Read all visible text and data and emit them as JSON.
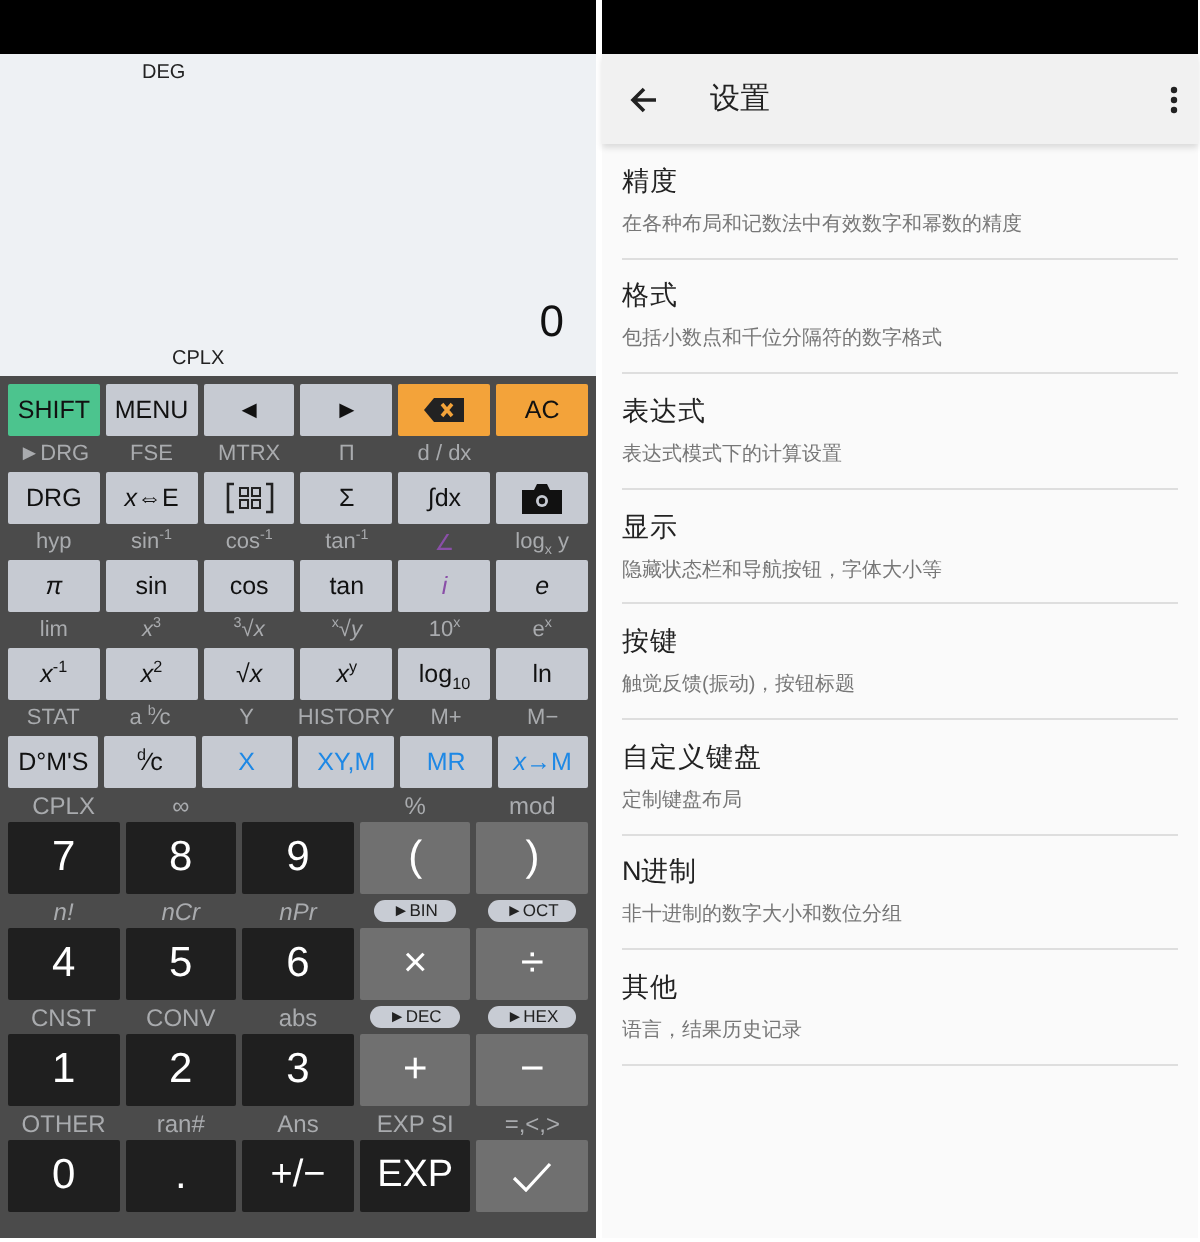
{
  "calculator": {
    "display": {
      "mode": "DEG",
      "value": "0",
      "indicator": "CPLX"
    },
    "rows": [
      {
        "keys": [
          {
            "label": "SHIFT",
            "kind": "green"
          },
          {
            "label": "MENU",
            "kind": "light"
          },
          {
            "label": "◄",
            "kind": "light"
          },
          {
            "label": "►",
            "kind": "light"
          },
          {
            "kind": "backspace"
          },
          {
            "label": "AC",
            "kind": "orange"
          }
        ]
      },
      {
        "keys": [
          {
            "shift": {
              "text": "►DRG",
              "kind": "text"
            },
            "label": "DRG",
            "kind": "light"
          },
          {
            "shift": {
              "text": "FSE",
              "kind": "text"
            },
            "label": "*x*⇔E",
            "kind": "light"
          },
          {
            "shift": {
              "text": "MTRX",
              "kind": "text"
            },
            "kind": "matrix"
          },
          {
            "shift": {
              "text": "Π",
              "kind": "text"
            },
            "label": "Σ",
            "kind": "light"
          },
          {
            "shift": {
              "text": "d / dx",
              "kind": "text"
            },
            "label": "∫dx",
            "kind": "light"
          },
          {
            "kind": "camera"
          }
        ]
      },
      {
        "keys": [
          {
            "shift": {
              "text": "hyp",
              "kind": "text"
            },
            "label": "*π*",
            "kind": "light"
          },
          {
            "shift": {
              "text": "sin$^{-1}$",
              "kind": "text"
            },
            "label": "sin",
            "kind": "light"
          },
          {
            "shift": {
              "text": "cos$^{-1}$",
              "kind": "text"
            },
            "label": "cos",
            "kind": "light"
          },
          {
            "shift": {
              "text": "tan$^{-1}$",
              "kind": "text"
            },
            "label": "tan",
            "kind": "light"
          },
          {
            "shift": {
              "text": "∠",
              "kind": "text",
              "color": "#8a4fa8"
            },
            "label": "*i*",
            "kind": "light",
            "color": "#8a4fa8"
          },
          {
            "shift": {
              "text": "log$_{x}$ y",
              "kind": "text"
            },
            "label": "*e*",
            "kind": "light"
          }
        ]
      },
      {
        "keys": [
          {
            "shift": {
              "text": "lim",
              "kind": "text"
            },
            "label": "*x*$^{-1}$",
            "kind": "light"
          },
          {
            "shift": {
              "text": "*x*$^{3}$",
              "kind": "text"
            },
            "label": "*x*$^{2}$",
            "kind": "light"
          },
          {
            "shift": {
              "text": "$^{3}$√*x*",
              "kind": "text"
            },
            "label": "√*x*",
            "kind": "light"
          },
          {
            "shift": {
              "text": "$^{x}$√*y*",
              "kind": "text"
            },
            "label": "*x*$^{y}$",
            "kind": "light"
          },
          {
            "shift": {
              "text": "10$^{x}$",
              "kind": "text"
            },
            "label": "log$_{10}$",
            "kind": "light"
          },
          {
            "shift": {
              "text": "e$^{x}$",
              "kind": "text"
            },
            "label": "ln",
            "kind": "light"
          }
        ]
      },
      {
        "keys": [
          {
            "shift": {
              "text": "STAT",
              "kind": "text"
            },
            "label": "D°M'S",
            "kind": "light"
          },
          {
            "shift": {
              "text": "a $^{b}$⁄c",
              "kind": "text"
            },
            "label": "$^{d}$⁄c",
            "kind": "light"
          },
          {
            "shift": {
              "text": "Y",
              "kind": "text"
            },
            "label": "X",
            "kind": "light",
            "color": "#1e88e5"
          },
          {
            "shift": {
              "text": "HISTORY",
              "kind": "text"
            },
            "label": "XY,M",
            "kind": "light",
            "color": "#1e88e5"
          },
          {
            "shift": {
              "text": "M+",
              "kind": "text"
            },
            "label": "MR",
            "kind": "light",
            "color": "#1e88e5"
          },
          {
            "shift": {
              "text": "M−",
              "kind": "text"
            },
            "label": "*x*→M",
            "kind": "light",
            "color": "#1e88e5"
          }
        ]
      },
      {
        "keys": [
          {
            "shift": {
              "text": "CPLX",
              "kind": "text"
            },
            "label": "7",
            "kind": "dark"
          },
          {
            "shift": {
              "text": "∞",
              "kind": "text"
            },
            "label": "8",
            "kind": "dark"
          },
          {
            "label": "9",
            "kind": "dark"
          },
          {
            "shift": {
              "text": "%",
              "kind": "text"
            },
            "label": "(",
            "kind": "mid"
          },
          {
            "shift": {
              "text": "mod",
              "kind": "text"
            },
            "label": ")",
            "kind": "mid"
          }
        ]
      },
      {
        "keys": [
          {
            "shift": {
              "text": "n!",
              "kind": "italic"
            },
            "label": "4",
            "kind": "dark"
          },
          {
            "shift": {
              "text": "nCr",
              "kind": "italic"
            },
            "label": "5",
            "kind": "dark"
          },
          {
            "shift": {
              "text": "nPr",
              "kind": "italic"
            },
            "label": "6",
            "kind": "dark"
          },
          {
            "shift": {
              "text": "►BIN",
              "kind": "pill"
            },
            "label": "×",
            "kind": "mid"
          },
          {
            "shift": {
              "text": "►OCT",
              "kind": "pill"
            },
            "label": "÷",
            "kind": "mid"
          }
        ]
      },
      {
        "keys": [
          {
            "shift": {
              "text": "CNST",
              "kind": "text"
            },
            "label": "1",
            "kind": "dark"
          },
          {
            "shift": {
              "text": "CONV",
              "kind": "text"
            },
            "label": "2",
            "kind": "dark"
          },
          {
            "shift": {
              "text": "abs",
              "kind": "text"
            },
            "label": "3",
            "kind": "dark"
          },
          {
            "shift": {
              "text": "►DEC",
              "kind": "pill"
            },
            "label": "+",
            "kind": "mid"
          },
          {
            "shift": {
              "text": "►HEX",
              "kind": "pill"
            },
            "label": "−",
            "kind": "mid"
          }
        ]
      },
      {
        "keys": [
          {
            "shift": {
              "text": "OTHER",
              "kind": "text"
            },
            "label": "0",
            "kind": "dark"
          },
          {
            "shift": {
              "text": "ran#",
              "kind": "text"
            },
            "label": ".",
            "kind": "dark"
          },
          {
            "shift": {
              "text": "Ans",
              "kind": "text"
            },
            "label": "+/−",
            "kind": "dark"
          },
          {
            "shift": {
              "text": "EXP SI",
              "kind": "text"
            },
            "label": "EXP",
            "kind": "dark"
          },
          {
            "shift": {
              "text": "=,<,>",
              "kind": "text"
            },
            "kind": "check"
          }
        ]
      }
    ]
  },
  "settings": {
    "title": "设置",
    "items": [
      {
        "title": "精度",
        "subtitle": "在各种布局和记数法中有效数字和幂数的精度"
      },
      {
        "title": "格式",
        "subtitle": "包括小数点和千位分隔符的数字格式"
      },
      {
        "title": "表达式",
        "subtitle": "表达式模式下的计算设置"
      },
      {
        "title": "显示",
        "subtitle": "隐藏状态栏和导航按钮，字体大小等"
      },
      {
        "title": "按键",
        "subtitle": "触觉反馈(振动)，按钮标题"
      },
      {
        "title": "自定义键盘",
        "subtitle": "定制键盘布局"
      },
      {
        "title": "N进制",
        "subtitle": "非十进制的数字大小和数位分组"
      },
      {
        "title": "其他",
        "subtitle": "语言，结果历史记录"
      }
    ]
  }
}
